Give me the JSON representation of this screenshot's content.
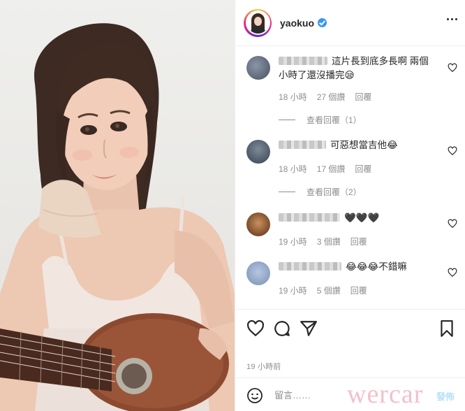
{
  "post": {
    "username": "yaokuo",
    "verified": true,
    "menu_icon": "more-horizontal-icon"
  },
  "comments": [
    {
      "text": "這片長到底多長啊 兩個小時了還沒播完😪",
      "time": "18 小時",
      "likes": "27 個讚",
      "reply": "回覆",
      "view_replies": "查看回覆（1）"
    },
    {
      "text": "可惡想當吉他😂",
      "time": "18 小時",
      "likes": "17 個讚",
      "reply": "回覆",
      "view_replies": "查看回覆（2）"
    },
    {
      "text": "🖤🖤🖤",
      "time": "19 小時",
      "likes": "3 個讚",
      "reply": "回覆"
    },
    {
      "text": "😂😂😂不錯嘛",
      "time": "19 小時",
      "likes": "5 個讚",
      "reply": "回覆"
    }
  ],
  "actions": {
    "like_icon": "heart-icon",
    "comment_icon": "comment-bubble-icon",
    "share_icon": "paper-plane-icon",
    "save_icon": "bookmark-icon"
  },
  "timestamp": "19 小時前",
  "composer": {
    "placeholder": "留言……",
    "post_label": "發佈",
    "emoji_icon": "smiley-icon"
  },
  "watermark": "wercar",
  "colors": {
    "accent": "#3897f0",
    "muted": "#8e8e8e",
    "border": "#efefef",
    "post_button_disabled": "#b2dffc"
  }
}
